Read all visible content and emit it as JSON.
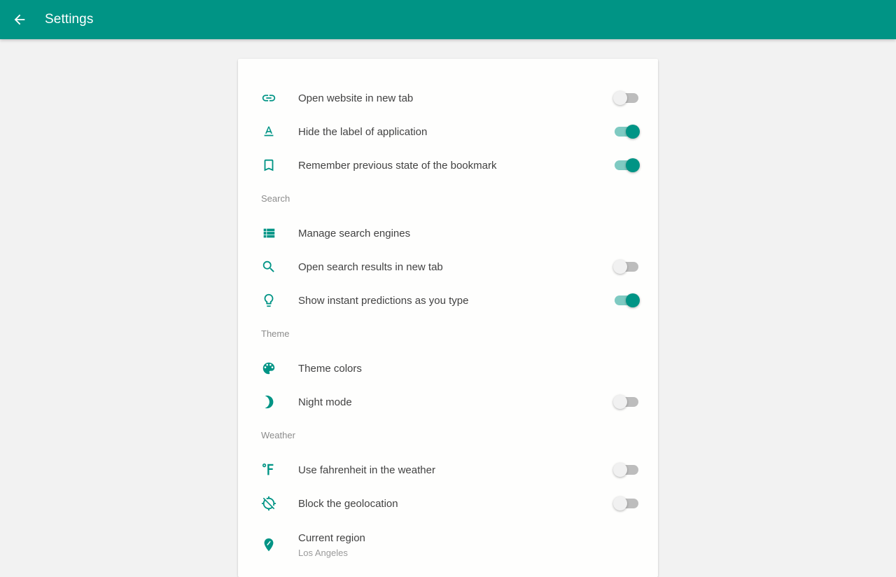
{
  "header": {
    "title": "Settings",
    "back_icon": "arrow-left-icon"
  },
  "colors": {
    "accent": "#009485",
    "accent_light": "#7fcac2",
    "background": "#f2f2f2"
  },
  "settings": {
    "general": [
      {
        "icon": "link-icon",
        "label": "Open website in new tab",
        "toggle": false
      },
      {
        "icon": "text-format-icon",
        "label": "Hide the label of application",
        "toggle": true
      },
      {
        "icon": "bookmark-icon",
        "label": "Remember previous state of the bookmark",
        "toggle": true
      }
    ],
    "search": {
      "header": "Search",
      "items": [
        {
          "icon": "list-icon",
          "label": "Manage search engines"
        },
        {
          "icon": "search-icon",
          "label": "Open search results in new tab",
          "toggle": false
        },
        {
          "icon": "lightbulb-icon",
          "label": "Show instant predictions as you type",
          "toggle": true
        }
      ]
    },
    "theme": {
      "header": "Theme",
      "items": [
        {
          "icon": "palette-icon",
          "label": "Theme colors"
        },
        {
          "icon": "moon-icon",
          "label": "Night mode",
          "toggle": false
        }
      ]
    },
    "weather": {
      "header": "Weather",
      "items": [
        {
          "icon": "fahrenheit-icon",
          "label": "Use fahrenheit in the weather",
          "toggle": false
        },
        {
          "icon": "location-off-icon",
          "label": "Block the geolocation",
          "toggle": false
        },
        {
          "icon": "place-icon",
          "label": "Current region",
          "sublabel": "Los Angeles"
        }
      ]
    }
  }
}
